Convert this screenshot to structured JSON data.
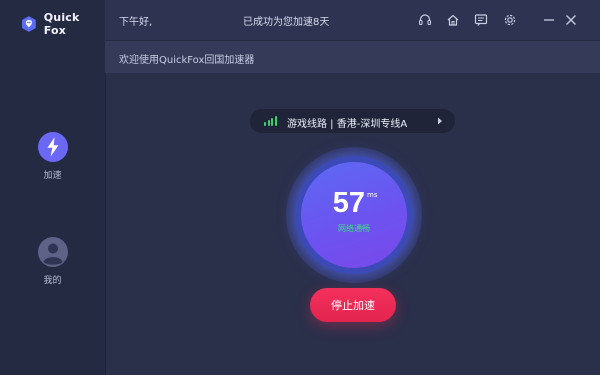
{
  "app": {
    "name": "Quick Fox",
    "brand_color": "#5b6cf6"
  },
  "topbar": {
    "greeting": "下午好,",
    "accel_days": "已成功为您加速8天",
    "icons": [
      "headset-icon",
      "home-icon",
      "message-icon",
      "settings-icon",
      "minimize-icon",
      "close-icon"
    ]
  },
  "subbar": {
    "welcome": "欢迎使用QuickFox回国加速器"
  },
  "sidebar": {
    "items": [
      {
        "label": "加速",
        "icon": "lightning-icon",
        "active": true
      },
      {
        "label": "我的",
        "icon": "avatar-icon",
        "active": false
      }
    ]
  },
  "route": {
    "text": "游戏线路 | 香港-深圳专线A",
    "signal_color": "#3ed06f"
  },
  "ping": {
    "value": "57",
    "unit": "ms",
    "status": "网络通畅",
    "status_color": "#3fdc86"
  },
  "actions": {
    "stop_label": "停止加速",
    "stop_color": "#f03059"
  }
}
